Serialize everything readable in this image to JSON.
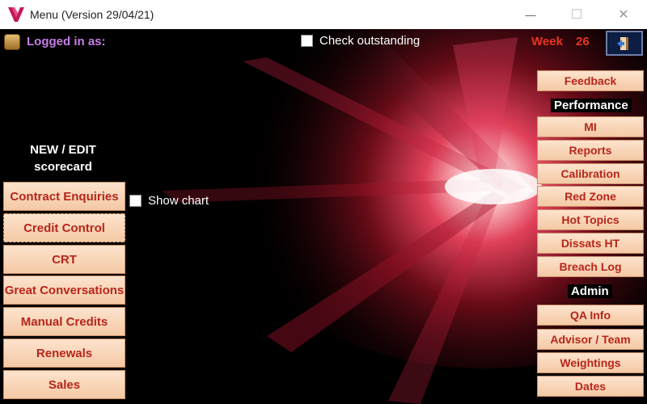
{
  "window": {
    "title": "Menu (Version 29/04/21)",
    "minimize_symbol": "—",
    "maximize_symbol": "☐",
    "close_symbol": "✕"
  },
  "header": {
    "logged_in_label": "Logged in as:",
    "check_outstanding_label": "Check outstanding",
    "check_outstanding_checked": false,
    "week_label": "Week",
    "week_number": "26",
    "user_icon": "user-icon",
    "exit_icon": "exit-door-icon"
  },
  "left_panel": {
    "heading_line1": "NEW / EDIT",
    "heading_line2": "scorecard",
    "show_chart_label": "Show chart",
    "show_chart_checked": false,
    "buttons": [
      "Contract Enquiries",
      "Credit Control",
      "CRT",
      "Great Conversations",
      "Manual Credits",
      "Renewals",
      "Sales"
    ]
  },
  "right_panel": {
    "feedback_label": "Feedback",
    "performance_heading": "Performance",
    "performance_buttons": [
      "MI",
      "Reports",
      "Calibration",
      "Red Zone",
      "Hot Topics",
      "Dissats HT",
      "Breach Log"
    ],
    "admin_heading": "Admin",
    "admin_buttons": [
      "QA Info",
      "Advisor / Team",
      "Weightings",
      "Dates"
    ]
  },
  "colors": {
    "accent_red": "#e8351e",
    "button_text": "#b7261b",
    "logged_in_purple": "#c77ee6",
    "exit_button_bg": "#0c1e44"
  }
}
